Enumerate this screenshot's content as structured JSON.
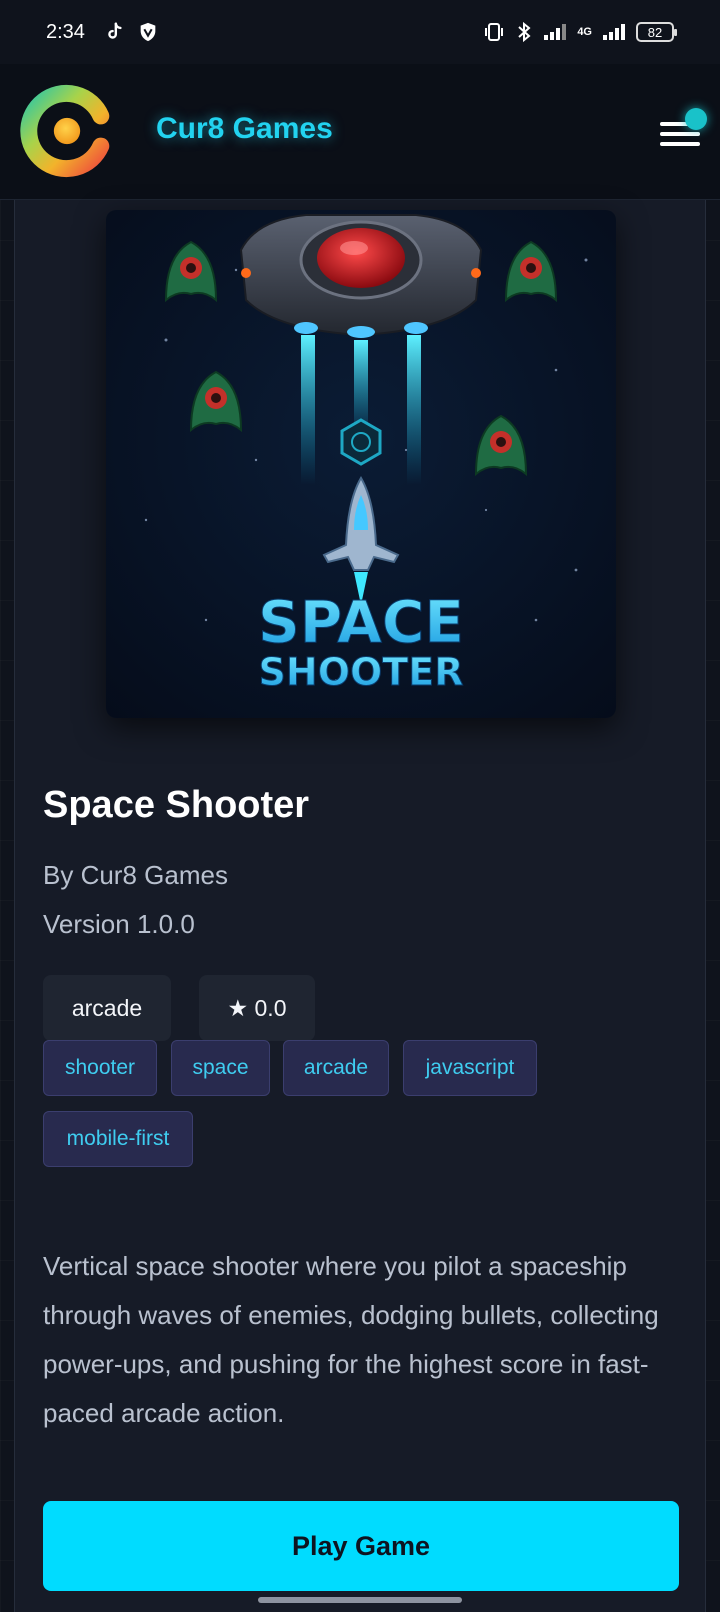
{
  "status_bar": {
    "time": "2:34",
    "app_icons": [
      "tiktok-icon",
      "vpn-icon"
    ],
    "system_icons": [
      "vibrate-icon",
      "bluetooth-icon",
      "signal-icon",
      "signal-4g-icon"
    ],
    "network": "4G",
    "battery": "82"
  },
  "header": {
    "brand": "Cur8 Games",
    "logo_icon": "cur8-logo-icon",
    "menu_icon": "hamburger-menu-icon"
  },
  "game": {
    "cover_title_line1": "SPACE",
    "cover_title_line2": "SHOOTER",
    "title": "Space Shooter",
    "author": "By Cur8 Games",
    "version": "Version 1.0.0",
    "category": "arcade",
    "rating": "★ 0.0",
    "tags": [
      "shooter",
      "space",
      "arcade",
      "javascript",
      "mobile-first"
    ],
    "description": "Vertical space shooter where you pilot a spaceship through waves of enemies, dodging bullets, collecting power-ups, and pushing for the highest score in fast-paced arcade action.",
    "play_label": "Play Game"
  },
  "colors": {
    "accent": "#00dcff",
    "brand_text": "#22d3f0",
    "tag_bg": "#282a4e",
    "tag_text": "#3fcdf0",
    "background": "#0f131c",
    "card": "#161b27"
  }
}
